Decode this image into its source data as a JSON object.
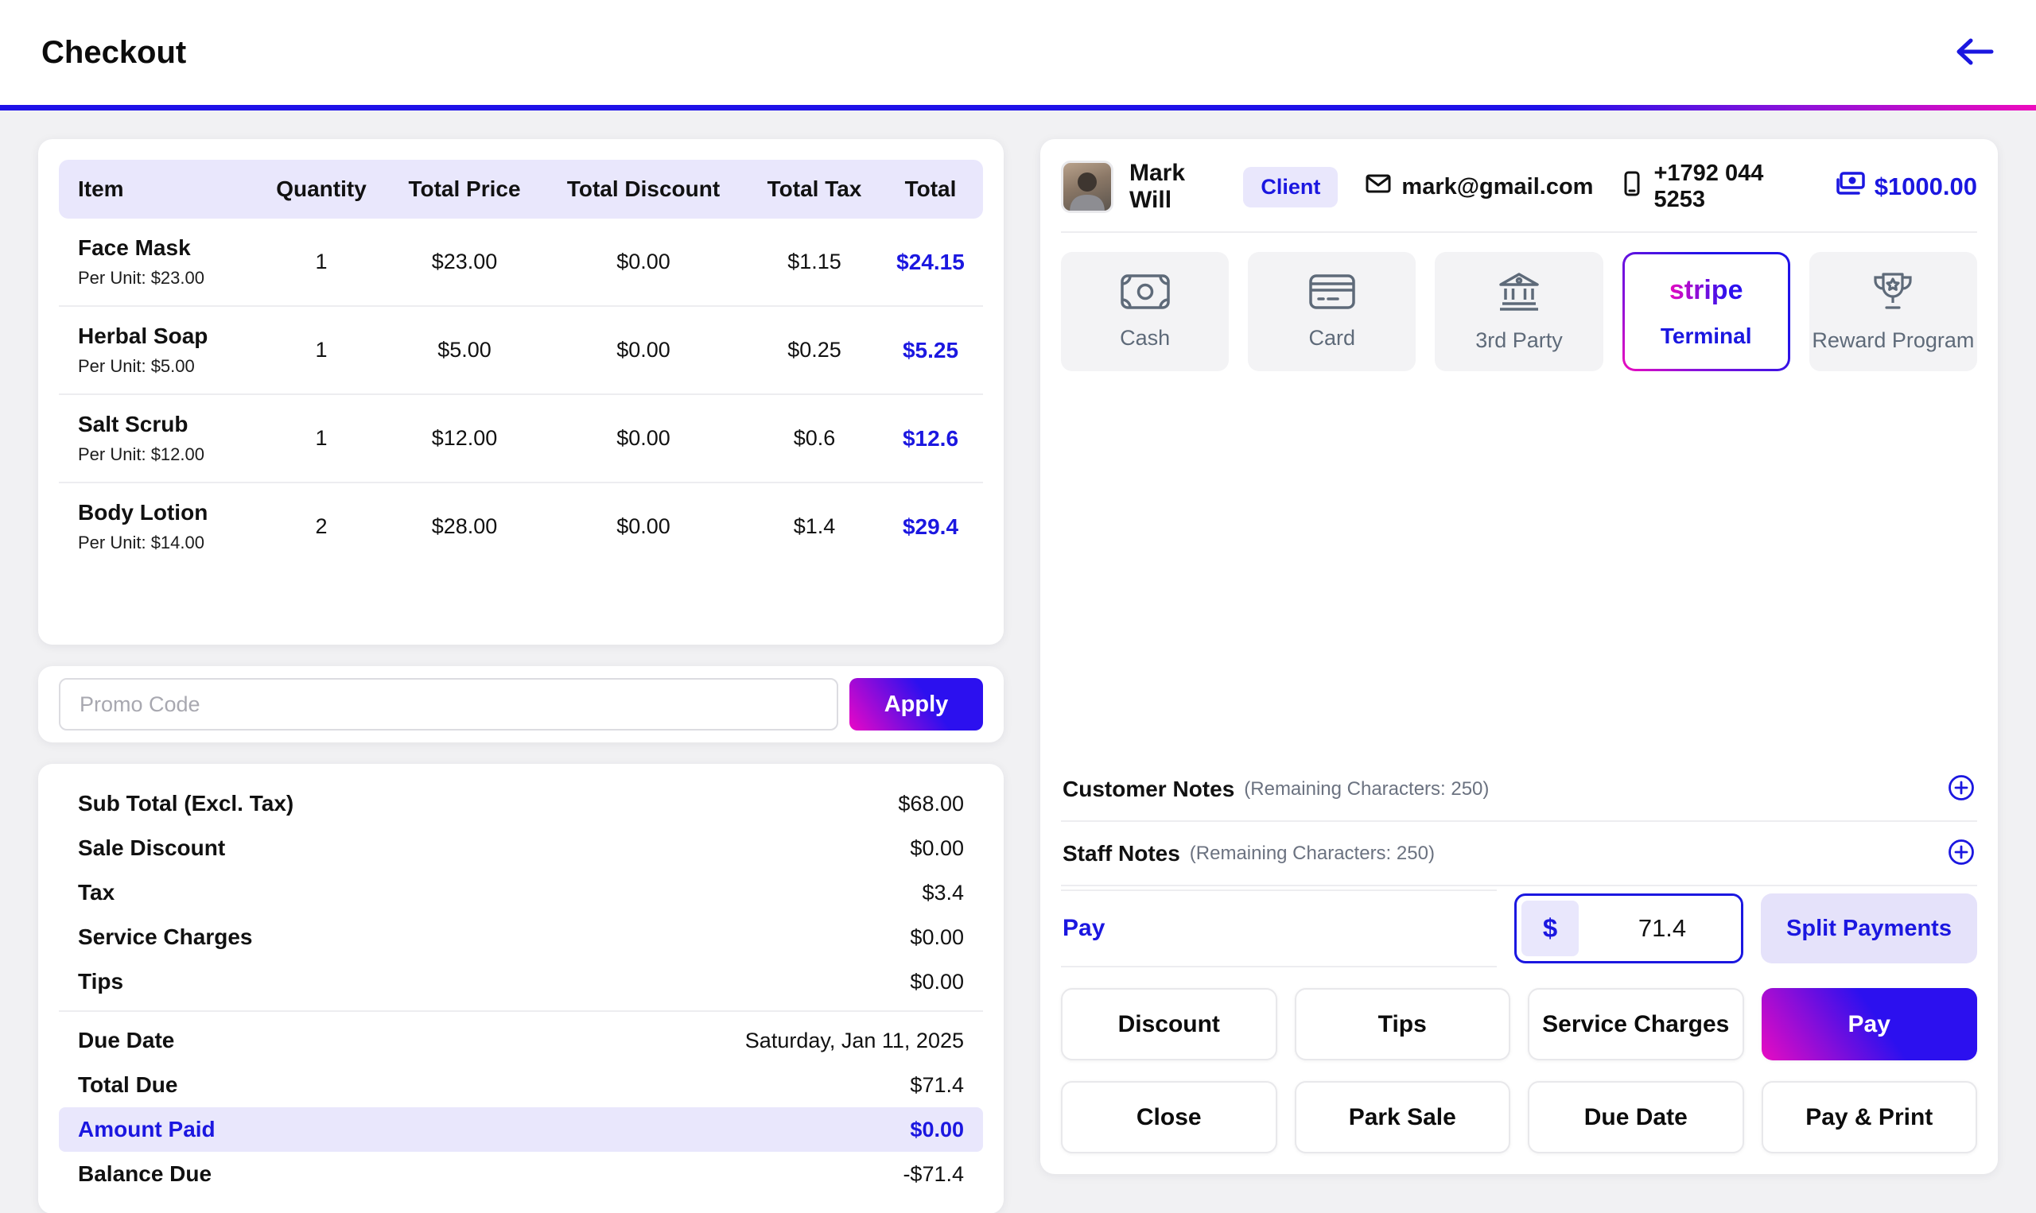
{
  "header": {
    "title": "Checkout"
  },
  "items_table": {
    "columns": [
      "Item",
      "Quantity",
      "Total Price",
      "Total Discount",
      "Total Tax",
      "Total"
    ],
    "rows": [
      {
        "name": "Face Mask",
        "per_unit": "Per Unit: $23.00",
        "quantity": "1",
        "total_price": "$23.00",
        "total_discount": "$0.00",
        "total_tax": "$1.15",
        "total": "$24.15"
      },
      {
        "name": "Herbal Soap",
        "per_unit": "Per Unit: $5.00",
        "quantity": "1",
        "total_price": "$5.00",
        "total_discount": "$0.00",
        "total_tax": "$0.25",
        "total": "$5.25"
      },
      {
        "name": "Salt Scrub",
        "per_unit": "Per Unit: $12.00",
        "quantity": "1",
        "total_price": "$12.00",
        "total_discount": "$0.00",
        "total_tax": "$0.6",
        "total": "$12.6"
      },
      {
        "name": "Body Lotion",
        "per_unit": "Per Unit: $14.00",
        "quantity": "2",
        "total_price": "$28.00",
        "total_discount": "$0.00",
        "total_tax": "$1.4",
        "total": "$29.4"
      }
    ]
  },
  "promo": {
    "placeholder": "Promo Code",
    "apply_label": "Apply"
  },
  "summary": {
    "rows": [
      {
        "label": "Sub Total (Excl. Tax)",
        "value": "$68.00"
      },
      {
        "label": "Sale Discount",
        "value": "$0.00"
      },
      {
        "label": "Tax",
        "value": "$3.4"
      },
      {
        "label": "Service Charges",
        "value": "$0.00"
      },
      {
        "label": "Tips",
        "value": "$0.00"
      }
    ],
    "due_rows": [
      {
        "label": "Due Date",
        "value": "Saturday, Jan 11, 2025"
      },
      {
        "label": "Total Due",
        "value": "$71.4"
      },
      {
        "label": "Amount Paid",
        "value": "$0.00"
      },
      {
        "label": "Balance Due",
        "value": "-$71.4"
      }
    ]
  },
  "client": {
    "name": "Mark Will",
    "badge": "Client",
    "email": "mark@gmail.com",
    "phone": "+1792 044 5253",
    "balance": "$1000.00"
  },
  "payment_methods": {
    "cash": "Cash",
    "card": "Card",
    "third_party": "3rd Party",
    "terminal_brand": "stripe",
    "terminal": "Terminal",
    "reward": "Reward Program"
  },
  "notes": {
    "customer_label": "Customer Notes",
    "customer_hint": "(Remaining Characters: 250)",
    "staff_label": "Staff Notes",
    "staff_hint": "(Remaining Characters: 250)"
  },
  "pay_section": {
    "label": "Pay",
    "currency": "$",
    "amount": "71.4",
    "split_label": "Split Payments"
  },
  "actions": {
    "discount": "Discount",
    "tips": "Tips",
    "service_charges": "Service Charges",
    "pay": "Pay",
    "close": "Close",
    "park_sale": "Park Sale",
    "due_date": "Due Date",
    "pay_print": "Pay & Print"
  },
  "colors": {
    "accent_blue": "#1b17e0",
    "accent_magenta": "#e80dc4",
    "lavender": "#e9e7fc",
    "tile_gray": "#f3f3f5",
    "icon_slate": "#5e6a79"
  }
}
